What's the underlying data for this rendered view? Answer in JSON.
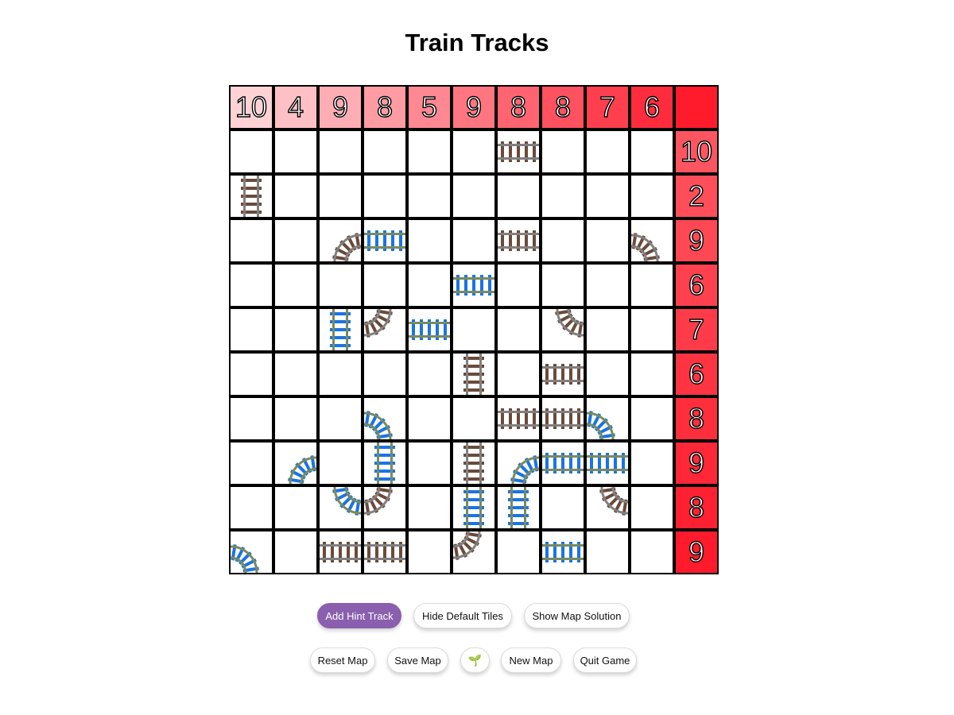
{
  "page": {
    "title": "Train Tracks"
  },
  "puzzle": {
    "column_clues": [
      "10",
      "4",
      "9",
      "8",
      "5",
      "9",
      "8",
      "8",
      "7",
      "6"
    ],
    "row_clues": [
      "10",
      "2",
      "9",
      "6",
      "7",
      "6",
      "8",
      "9",
      "8",
      "9"
    ],
    "tiles": [
      {
        "row": 0,
        "col": 6,
        "type": "h",
        "style": "default"
      },
      {
        "row": 1,
        "col": 0,
        "type": "v",
        "style": "default"
      },
      {
        "row": 2,
        "col": 2,
        "type": "es",
        "style": "default"
      },
      {
        "row": 2,
        "col": 3,
        "type": "h",
        "style": "hint"
      },
      {
        "row": 2,
        "col": 6,
        "type": "h",
        "style": "default"
      },
      {
        "row": 2,
        "col": 9,
        "type": "ws",
        "style": "default"
      },
      {
        "row": 3,
        "col": 5,
        "type": "h",
        "style": "hint"
      },
      {
        "row": 4,
        "col": 2,
        "type": "v",
        "style": "hint"
      },
      {
        "row": 4,
        "col": 3,
        "type": "wn",
        "style": "default"
      },
      {
        "row": 4,
        "col": 4,
        "type": "h",
        "style": "hint"
      },
      {
        "row": 4,
        "col": 7,
        "type": "en",
        "style": "default"
      },
      {
        "row": 5,
        "col": 5,
        "type": "v",
        "style": "default"
      },
      {
        "row": 5,
        "col": 7,
        "type": "h",
        "style": "default"
      },
      {
        "row": 6,
        "col": 3,
        "type": "ws",
        "style": "hint"
      },
      {
        "row": 6,
        "col": 6,
        "type": "h",
        "style": "default"
      },
      {
        "row": 6,
        "col": 7,
        "type": "h",
        "style": "default"
      },
      {
        "row": 6,
        "col": 8,
        "type": "ws",
        "style": "hint"
      },
      {
        "row": 7,
        "col": 1,
        "type": "es",
        "style": "hint"
      },
      {
        "row": 7,
        "col": 3,
        "type": "v",
        "style": "hint"
      },
      {
        "row": 7,
        "col": 5,
        "type": "v",
        "style": "default"
      },
      {
        "row": 7,
        "col": 6,
        "type": "es",
        "style": "hint"
      },
      {
        "row": 7,
        "col": 7,
        "type": "h",
        "style": "hint"
      },
      {
        "row": 7,
        "col": 8,
        "type": "h",
        "style": "hint"
      },
      {
        "row": 8,
        "col": 2,
        "type": "en",
        "style": "hint"
      },
      {
        "row": 8,
        "col": 3,
        "type": "wn",
        "style": "default"
      },
      {
        "row": 8,
        "col": 5,
        "type": "v",
        "style": "hint"
      },
      {
        "row": 8,
        "col": 6,
        "type": "v",
        "style": "hint"
      },
      {
        "row": 8,
        "col": 8,
        "type": "en",
        "style": "default"
      },
      {
        "row": 9,
        "col": 0,
        "type": "ws",
        "style": "hint"
      },
      {
        "row": 9,
        "col": 2,
        "type": "h",
        "style": "default"
      },
      {
        "row": 9,
        "col": 3,
        "type": "h",
        "style": "default"
      },
      {
        "row": 9,
        "col": 5,
        "type": "wn",
        "style": "default"
      },
      {
        "row": 9,
        "col": 7,
        "type": "h",
        "style": "hint"
      }
    ]
  },
  "colors": {
    "header_light": "#ffd2d6",
    "header_dark": "#ff1a2c",
    "default_tie": "#6b4a3a",
    "default_rail": "#808080",
    "hint_tie": "#1a73e8",
    "hint_rail": "#7a8a5a",
    "primary_button": "#8a5fae"
  },
  "buttons": {
    "add_hint": "Add Hint Track",
    "hide_default": "Hide Default Tiles",
    "show_solution": "Show Map Solution",
    "reset": "Reset Map",
    "save": "Save Map",
    "sprout_icon": "🌱",
    "new_map": "New Map",
    "quit": "Quit Game"
  }
}
